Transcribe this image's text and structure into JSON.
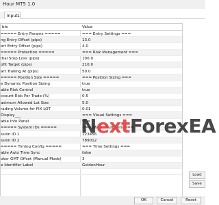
{
  "window": {
    "title": "Hour MT5 1.0"
  },
  "tabs": {
    "left": "",
    "inputs": "Inputs"
  },
  "grid": {
    "header_variable": "ble",
    "header_value": "Value",
    "rows": [
      {
        "variable": "===== Entry Params =====",
        "value": "=== Entry Settings ==="
      },
      {
        "variable": "ng Entry Offset (pips)",
        "value": "13.0"
      },
      {
        "variable": "ort Entry Offset (pips)",
        "value": "4.0"
      },
      {
        "variable": "===== Protection =====",
        "value": "=== Risk Management ==="
      },
      {
        "variable": "itial Stop Loss (pips)",
        "value": "100.0"
      },
      {
        "variable": "ofit Target (pips)",
        "value": "210.0"
      },
      {
        "variable": "art Trailing At (pips)",
        "value": "50.0"
      },
      {
        "variable": "===== Position Size =====",
        "value": "=== Position Sizing ==="
      },
      {
        "variable": "e Dynamic Position Sizing",
        "value": "true"
      },
      {
        "variable": "able Risk Control",
        "value": "true"
      },
      {
        "variable": "ccount Risk Per Trade (%)",
        "value": "0.5"
      },
      {
        "variable": "aximum Allowed Lot Size",
        "value": "5.0"
      },
      {
        "variable": "rading Volume for FIX LOT",
        "value": "0.01"
      },
      {
        "variable": "Display___",
        "value": "=== Visual Settings ==="
      },
      {
        "variable": "able Info Panel",
        "value": "true"
      },
      {
        "variable": "===== System IDs =====",
        "value": "=== Magic Numbers ==="
      },
      {
        "variable": "ssion ID 1",
        "value": "123456"
      },
      {
        "variable": "ssion ID 2",
        "value": "789012"
      },
      {
        "variable": "===== Timing Config =====",
        "value": "=== Time Settings ==="
      },
      {
        "variable": "able Auto Time Sync",
        "value": "false"
      },
      {
        "variable": "oker GMT Offset (Manual Mode)",
        "value": "3"
      },
      {
        "variable": "e Identifier Label",
        "value": "GoldenHour"
      },
      {
        "variable": "",
        "value": ""
      }
    ]
  },
  "watermark": {
    "part1": "N",
    "part2": "ext",
    "part3": "ForexEA"
  },
  "side_buttons": {
    "load": "Load",
    "save": "Save"
  },
  "bottom_buttons": {
    "ok": "OK",
    "cancel": "Cancel",
    "reset": "Reset"
  },
  "colors": {
    "watermark_dark": "#2a2a2a",
    "watermark_accent": "#e23d3d",
    "alt_row": "#f2f2f2"
  }
}
